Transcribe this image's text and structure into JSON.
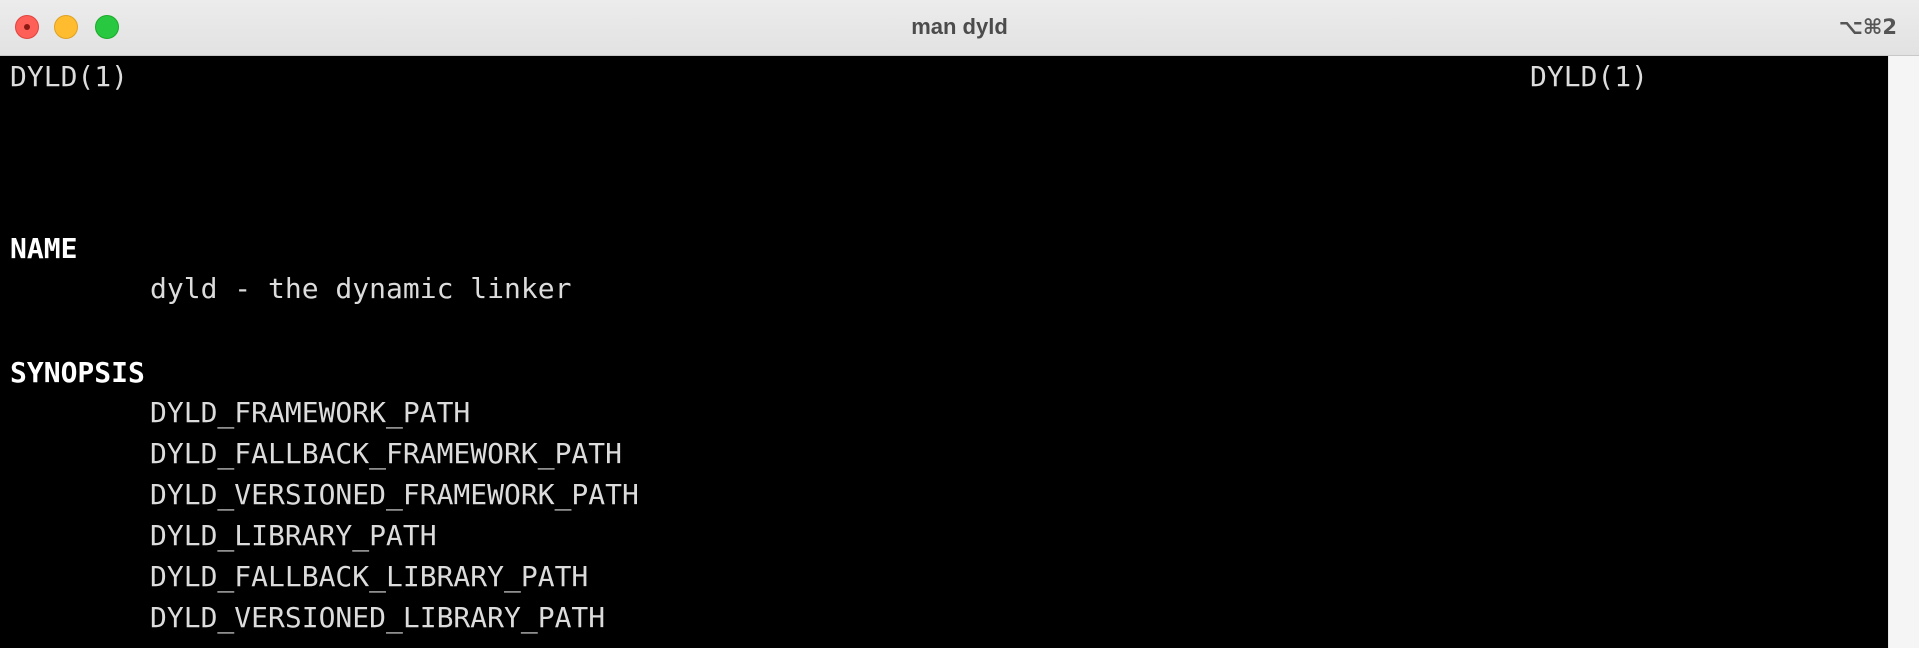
{
  "window": {
    "title": "man dyld",
    "shortcut": "⌥⌘2"
  },
  "terminal": {
    "header_left": "DYLD(1)",
    "header_right": "DYLD(1)",
    "sections": [
      {
        "heading": "NAME",
        "lines": [
          "dyld - the dynamic linker"
        ]
      },
      {
        "heading": "SYNOPSIS",
        "lines": [
          "DYLD_FRAMEWORK_PATH",
          "DYLD_FALLBACK_FRAMEWORK_PATH",
          "DYLD_VERSIONED_FRAMEWORK_PATH",
          "DYLD_LIBRARY_PATH",
          "DYLD_FALLBACK_LIBRARY_PATH",
          "DYLD_VERSIONED_LIBRARY_PATH"
        ]
      }
    ]
  },
  "colors": {
    "background": "#000000",
    "text": "#dcdcdc",
    "titlebar": "#e6e6e6"
  }
}
